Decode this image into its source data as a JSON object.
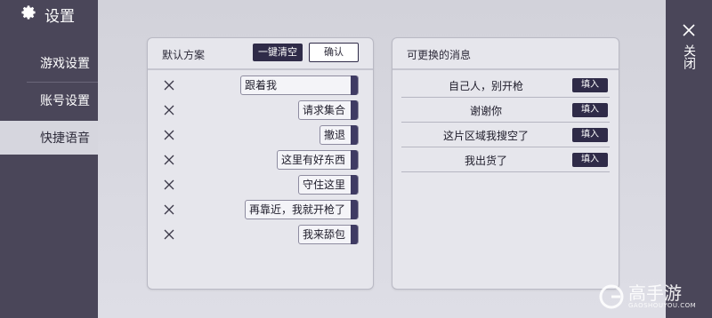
{
  "sidebar": {
    "title": "设置",
    "items": [
      {
        "label": "游戏设置"
      },
      {
        "label": "账号设置"
      },
      {
        "label": "快捷语音"
      }
    ]
  },
  "left_panel": {
    "title": "默认方案",
    "clear_button": "一键清空",
    "confirm_button": "确认",
    "slots": [
      {
        "label": "跟着我"
      },
      {
        "label": "请求集合"
      },
      {
        "label": "撤退"
      },
      {
        "label": "这里有好东西"
      },
      {
        "label": "守住这里"
      },
      {
        "label": "再靠近，我就开枪了"
      },
      {
        "label": "我来舔包"
      }
    ]
  },
  "right_panel": {
    "title": "可更换的消息",
    "fill_label": "填入",
    "messages": [
      {
        "text": "自己人，别开枪"
      },
      {
        "text": "谢谢你"
      },
      {
        "text": "这片区域我搜空了"
      },
      {
        "text": "我出货了"
      }
    ]
  },
  "close": {
    "label": "关闭"
  },
  "watermark": {
    "text": "高手游",
    "sub": "GAOSHOUYOU.COM"
  },
  "colors": {
    "sidebar": "#4a4659",
    "accent": "#2f2b48",
    "background": "#d6d6de"
  }
}
